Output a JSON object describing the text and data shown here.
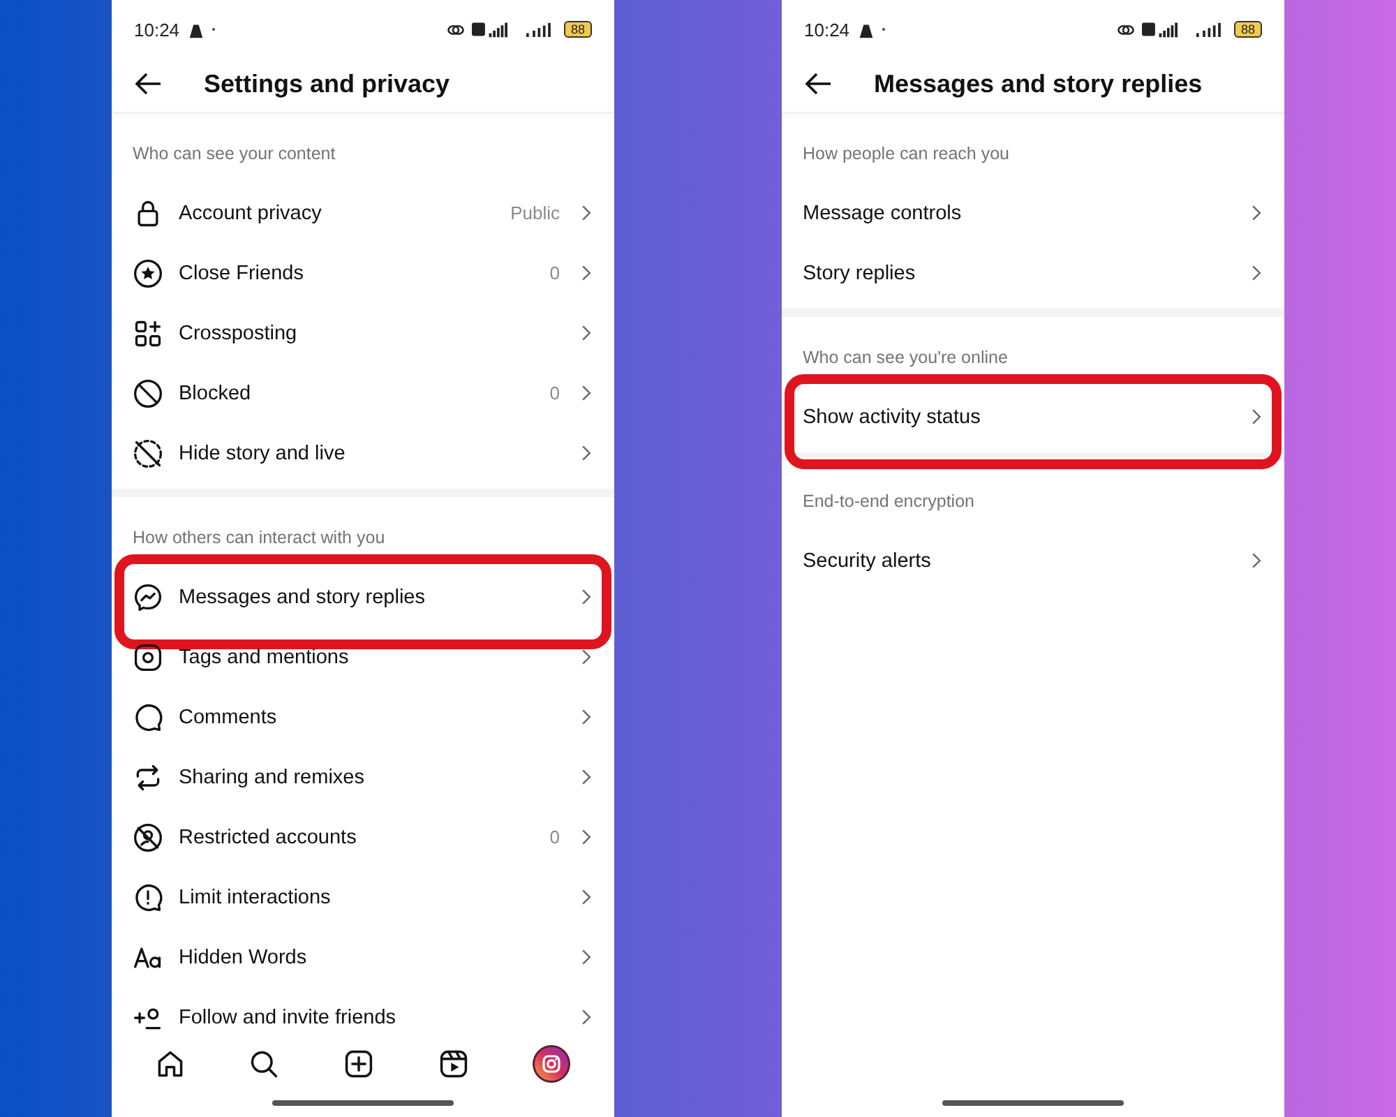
{
  "screens": [
    {
      "status_bar": {
        "time": "10:24",
        "battery": "88"
      },
      "title": "Settings and privacy",
      "bottom_nav": true,
      "sections": [
        {
          "heading": "Who can see your content",
          "items": [
            {
              "kind": "lock",
              "label": "Account privacy",
              "value": "Public",
              "highlighted": false
            },
            {
              "kind": "star",
              "label": "Close Friends",
              "value": "0",
              "highlighted": false
            },
            {
              "kind": "crosspost",
              "label": "Crossposting",
              "highlighted": false
            },
            {
              "kind": "blocked",
              "label": "Blocked",
              "value": "0",
              "highlighted": false
            },
            {
              "kind": "hide",
              "label": "Hide story and live",
              "highlighted": false
            }
          ]
        },
        {
          "heading": "How others can interact with you",
          "items": [
            {
              "kind": "messenger",
              "label": "Messages and story replies",
              "highlighted": true
            },
            {
              "kind": "tag",
              "label": "Tags and mentions",
              "highlighted": false
            },
            {
              "kind": "comment",
              "label": "Comments",
              "highlighted": false
            },
            {
              "kind": "share",
              "label": "Sharing and remixes",
              "highlighted": false
            },
            {
              "kind": "restricted",
              "label": "Restricted accounts",
              "value": "0",
              "highlighted": false
            },
            {
              "kind": "limit",
              "label": "Limit interactions",
              "highlighted": false
            },
            {
              "kind": "text",
              "label": "Hidden Words",
              "highlighted": false
            },
            {
              "kind": "follow",
              "label": "Follow and invite friends",
              "highlighted": false
            }
          ]
        }
      ]
    },
    {
      "status_bar": {
        "time": "10:24",
        "battery": "88"
      },
      "title": "Messages and story replies",
      "bottom_nav": false,
      "sections": [
        {
          "heading": "How people can reach you",
          "items": [
            {
              "label": "Message controls",
              "highlighted": false
            },
            {
              "label": "Story replies",
              "highlighted": false
            }
          ]
        },
        {
          "heading": "Who can see you're online",
          "items": [
            {
              "label": "Show activity status",
              "highlighted": true
            }
          ]
        },
        {
          "heading": "End-to-end encryption",
          "items": [
            {
              "label": "Security alerts",
              "highlighted": false
            }
          ]
        }
      ]
    }
  ]
}
